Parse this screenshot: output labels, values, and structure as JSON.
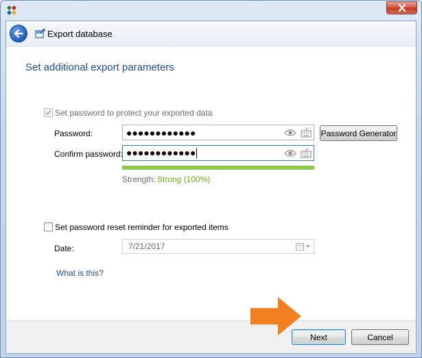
{
  "window": {
    "app_icon": "app-logo-icon",
    "close_icon": "close-icon"
  },
  "header": {
    "back_icon": "back-arrow-icon",
    "export_icon": "export-database-icon",
    "title": "Export database"
  },
  "section": {
    "title": "Set additional export parameters"
  },
  "password_protection": {
    "checkbox_label": "Set password to protect your exported data",
    "checked": true,
    "password_label": "Password:",
    "password_mask": "●●●●●●●●●●●●",
    "confirm_label": "Confirm password:",
    "confirm_mask": "●●●●●●●●●●●●",
    "generator_button": "Password Generator",
    "strength_label": "Strength:",
    "strength_value": "Strong (100%)",
    "strength_fraction": 1.0,
    "strength_color": "#8ccb4f"
  },
  "reminder": {
    "checkbox_label": "Set password reset reminder for exported items",
    "checked": false,
    "date_label": "Date:",
    "date_value": "7/21/2017"
  },
  "help_link": "What is this?",
  "footer": {
    "next_button": "Next",
    "cancel_button": "Cancel"
  },
  "colors": {
    "accent": "#1e4d92",
    "strength_text": "#6aaf1e",
    "pointer": "#f28020"
  }
}
